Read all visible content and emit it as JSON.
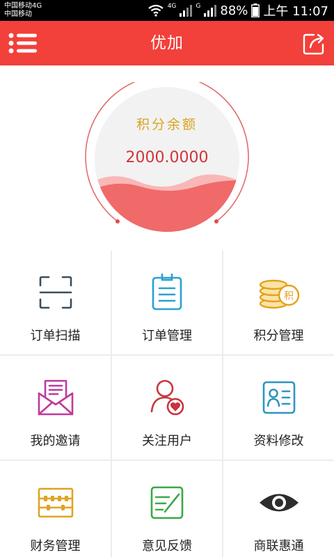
{
  "status_bar": {
    "carrier_line1": "中国移动4G",
    "carrier_line2": "中国移动",
    "network_4g": "4G",
    "network_g": "G",
    "battery": "88%",
    "time": "上午 11:07"
  },
  "header": {
    "title": "优加",
    "left_icon": "menu-list-icon",
    "right_icon": "share-icon",
    "accent_color": "#f2403a"
  },
  "balance": {
    "label": "积分余额",
    "value": "2000.0000",
    "label_color": "#d9a520",
    "value_color": "#d0343a"
  },
  "menu": {
    "items": [
      {
        "label": "订单扫描",
        "icon": "scan-icon"
      },
      {
        "label": "订单管理",
        "icon": "clipboard-icon"
      },
      {
        "label": "积分管理",
        "icon": "coins-icon",
        "icon_text": "积"
      },
      {
        "label": "我的邀请",
        "icon": "envelope-icon"
      },
      {
        "label": "关注用户",
        "icon": "user-heart-icon"
      },
      {
        "label": "资料修改",
        "icon": "id-card-icon"
      },
      {
        "label": "财务管理",
        "icon": "abacus-icon"
      },
      {
        "label": "意见反馈",
        "icon": "feedback-icon"
      },
      {
        "label": "商联惠通",
        "icon": "eye-icon"
      }
    ]
  }
}
